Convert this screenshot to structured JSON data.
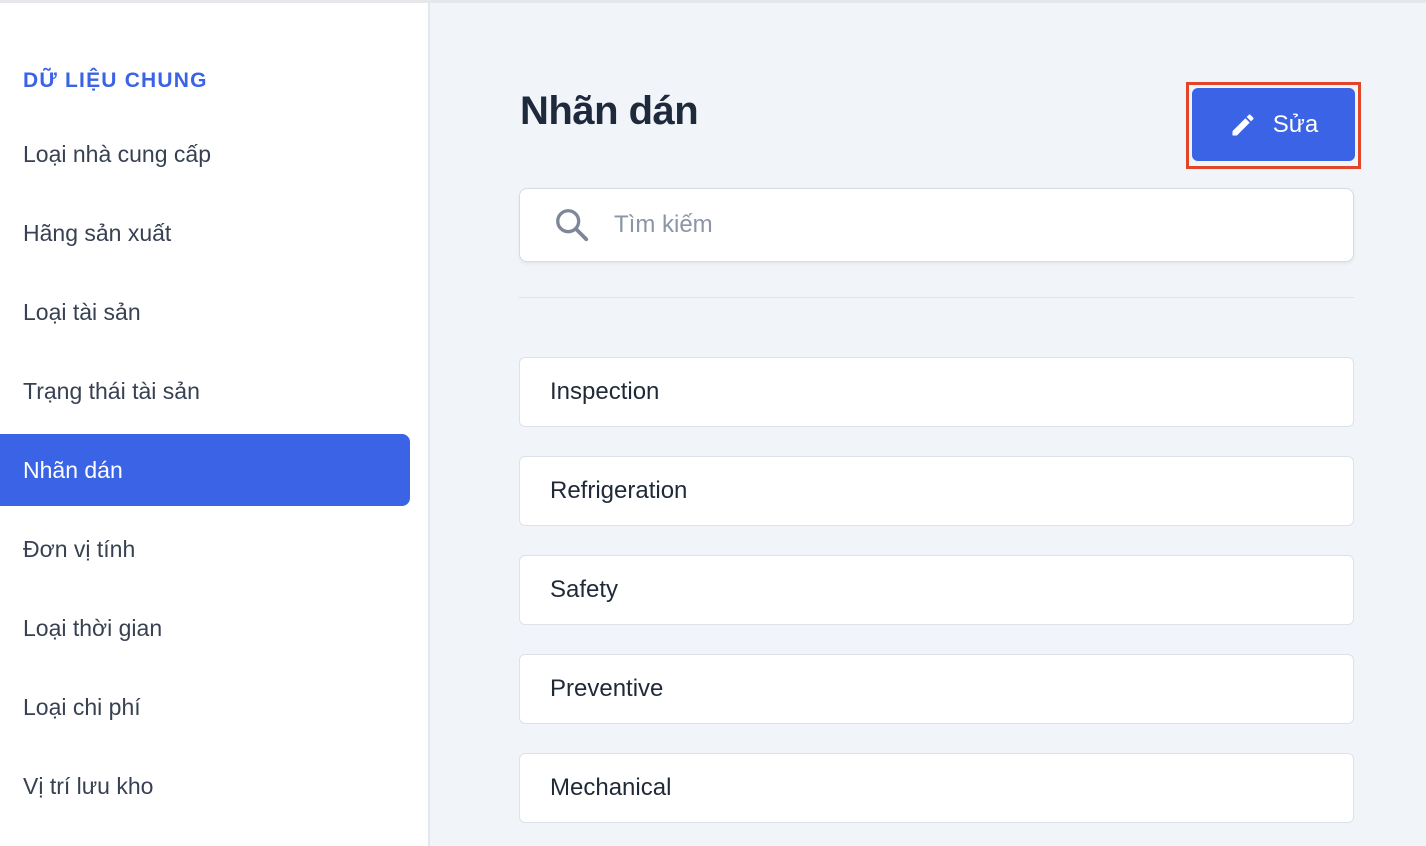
{
  "sidebar": {
    "heading": "DỮ LIỆU CHUNG",
    "items": [
      {
        "label": "Loại nhà cung cấp"
      },
      {
        "label": "Hãng sản xuất"
      },
      {
        "label": "Loại tài sản"
      },
      {
        "label": "Trạng thái tài sản"
      },
      {
        "label": "Nhãn dán",
        "active": true
      },
      {
        "label": "Đơn vị tính"
      },
      {
        "label": "Loại thời gian"
      },
      {
        "label": "Loại chi phí"
      },
      {
        "label": "Vị trí lưu kho"
      }
    ]
  },
  "main": {
    "title": "Nhãn dán",
    "edit_button": {
      "label": "Sửa",
      "icon": "pencil-icon"
    },
    "search": {
      "placeholder": "Tìm kiếm",
      "value": "",
      "icon": "search-icon"
    },
    "labels": [
      {
        "name": "Inspection"
      },
      {
        "name": "Refrigeration"
      },
      {
        "name": "Safety"
      },
      {
        "name": "Preventive"
      },
      {
        "name": "Mechanical"
      }
    ]
  },
  "colors": {
    "accent": "#3b63e6",
    "highlight_border": "#e2462a",
    "page_background": "#f1f4f9"
  }
}
